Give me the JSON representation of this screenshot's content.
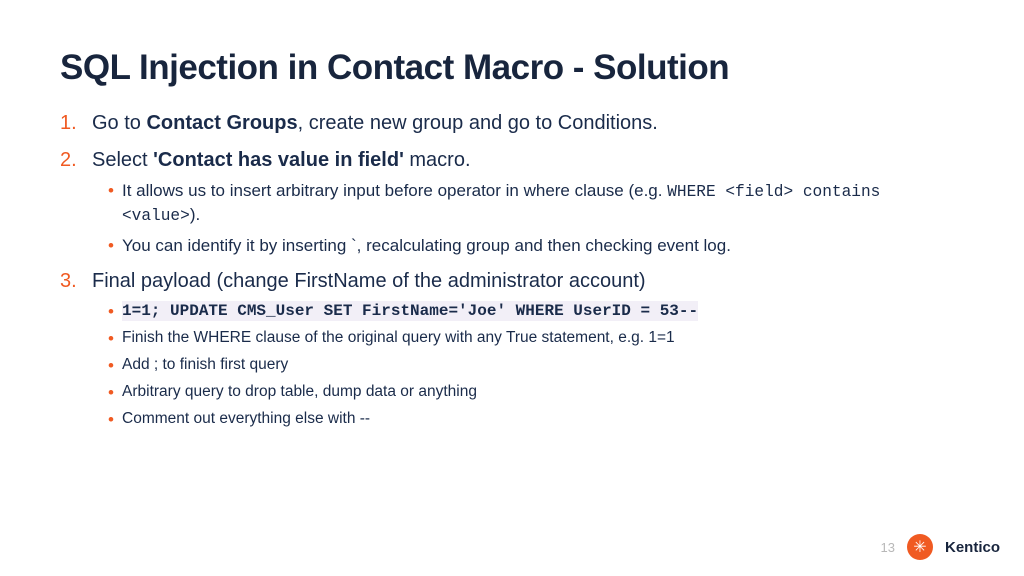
{
  "title": "SQL Injection in Contact Macro - Solution",
  "steps": [
    {
      "pre": "Go to ",
      "bold": "Contact Groups",
      "post": ", create new group and go to Conditions."
    },
    {
      "pre": "Select ",
      "bold": "'Contact has value in field'",
      "post": " macro.",
      "sub": [
        {
          "pre": "It allows us to insert arbitrary input before operator in where clause (e.g. ",
          "code": "WHERE <field> contains <value>",
          "post": ")."
        },
        {
          "text": "You can identify it by inserting `, recalculating group and then checking event log."
        }
      ]
    },
    {
      "text": "Final payload (change FirstName of the administrator account)",
      "sub_small": [
        {
          "code_hl": "1=1; UPDATE CMS_User SET FirstName='Joe' WHERE UserID = 53--"
        },
        {
          "text": "Finish the WHERE clause of the original query with any True statement, e.g. 1=1"
        },
        {
          "text": "Add ; to finish first query"
        },
        {
          "text": "Arbitrary query to drop table, dump data or anything"
        },
        {
          "text": "Comment out everything else with --"
        }
      ]
    }
  ],
  "page_number": "13",
  "brand": "Kentico",
  "logo_glyph": "✳"
}
